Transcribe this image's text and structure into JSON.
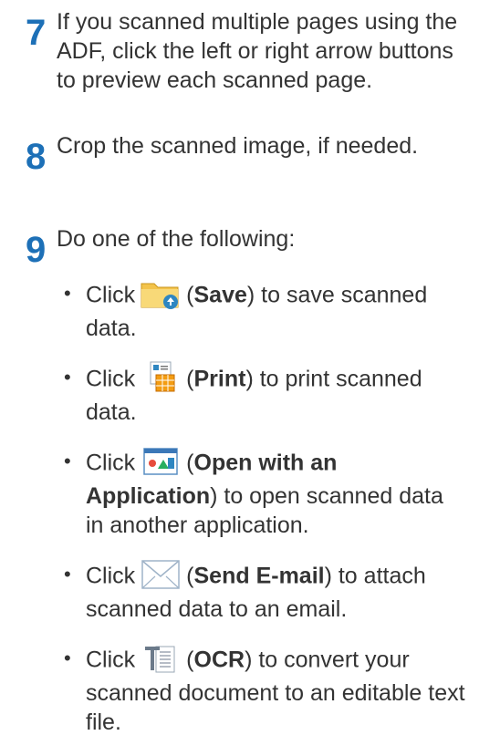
{
  "steps": [
    {
      "num": "7",
      "lines": [
        "If you scanned multiple pages using the",
        "ADF, click the left or right arrow buttons",
        "to preview each scanned page."
      ]
    },
    {
      "num": "8",
      "lines": [
        "Crop the scanned image, if needed."
      ]
    },
    {
      "num": "9",
      "lines": [
        "Do one of the following:"
      ]
    }
  ],
  "options": [
    {
      "click": "Click",
      "icon": "save-folder-icon",
      "label": "Save",
      "l1": ") to save scanned",
      "l2": "data."
    },
    {
      "click": "Click",
      "icon": "print-icon",
      "label": "Print",
      "l1": ") to print scanned",
      "l2": "data."
    },
    {
      "click": "Click",
      "icon": "open-application-icon",
      "label1": "Open with an",
      "label2": "Application",
      "l2": ") to open scanned data",
      "l3": "in another application."
    },
    {
      "click": "Click",
      "icon": "email-envelope-icon",
      "label": "Send E-mail",
      "l1": ") to attach",
      "l2": "scanned data to an email."
    },
    {
      "click": "Click",
      "icon": "ocr-text-icon",
      "label": "OCR",
      "l1": ") to convert your",
      "l2": "scanned document to an editable text",
      "l3": "file."
    }
  ],
  "bullet_char": "•",
  "open_paren": "(",
  "colors": {
    "step_number": "#1d70b7",
    "text": "#333333"
  }
}
